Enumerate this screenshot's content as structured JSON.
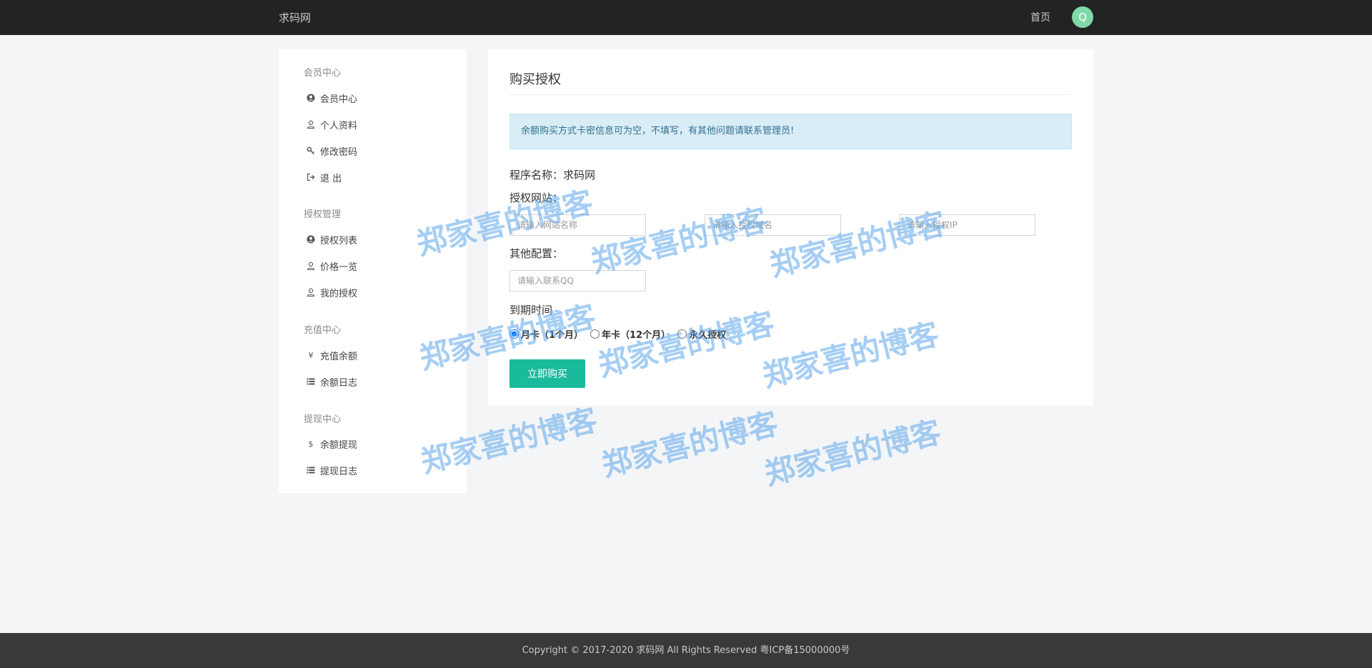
{
  "header": {
    "brand": "求码网",
    "nav_home": "首页",
    "avatar_letter": "Q",
    "avatar_color": "#7fd8a7"
  },
  "sidebar": {
    "groups": [
      {
        "title": "会员中心",
        "items": [
          {
            "label": "会员中心",
            "icon": "user-circle-icon"
          },
          {
            "label": "个人资料",
            "icon": "user-icon"
          },
          {
            "label": "修改密码",
            "icon": "key-icon"
          },
          {
            "label": "退 出",
            "icon": "sign-out-icon"
          }
        ]
      },
      {
        "title": "授权管理",
        "items": [
          {
            "label": "授权列表",
            "icon": "user-circle-icon"
          },
          {
            "label": "价格一览",
            "icon": "user-icon"
          },
          {
            "label": "我的授权",
            "icon": "user-icon"
          }
        ]
      },
      {
        "title": "充值中心",
        "items": [
          {
            "label": "充值余额",
            "icon": "yen-icon"
          },
          {
            "label": "余额日志",
            "icon": "list-icon"
          }
        ]
      },
      {
        "title": "提现中心",
        "items": [
          {
            "label": "余额提现",
            "icon": "dollar-icon"
          },
          {
            "label": "提现日志",
            "icon": "list-icon"
          }
        ]
      }
    ]
  },
  "main": {
    "title": "购买授权",
    "alert": "余额购买方式卡密信息可为空，不填写，有其他问题请联系管理员!",
    "alert_color": "#d9edf7",
    "program_label": "程序名称：求码网",
    "site_label": "授权网站：",
    "site_name_placeholder": "请输入网站名称",
    "domain_placeholder": "请输入授权域名",
    "ip_placeholder": "请输入授权IP",
    "other_label": "其他配置：",
    "qq_placeholder": "请输入联系QQ",
    "expiry_label": "到期时间",
    "options": [
      {
        "label": "月卡（1个月）",
        "checked": true
      },
      {
        "label": "年卡（12个月）",
        "checked": false
      },
      {
        "label": "永久授权",
        "checked": false
      }
    ],
    "buy_button": "立即购买",
    "button_color": "#1aba9c"
  },
  "watermark_text": "郑家喜的博客",
  "footer": {
    "copyright": "Copyright © 2017-2020 求码网 All Rights Reserved 粤ICP备15000000号"
  }
}
